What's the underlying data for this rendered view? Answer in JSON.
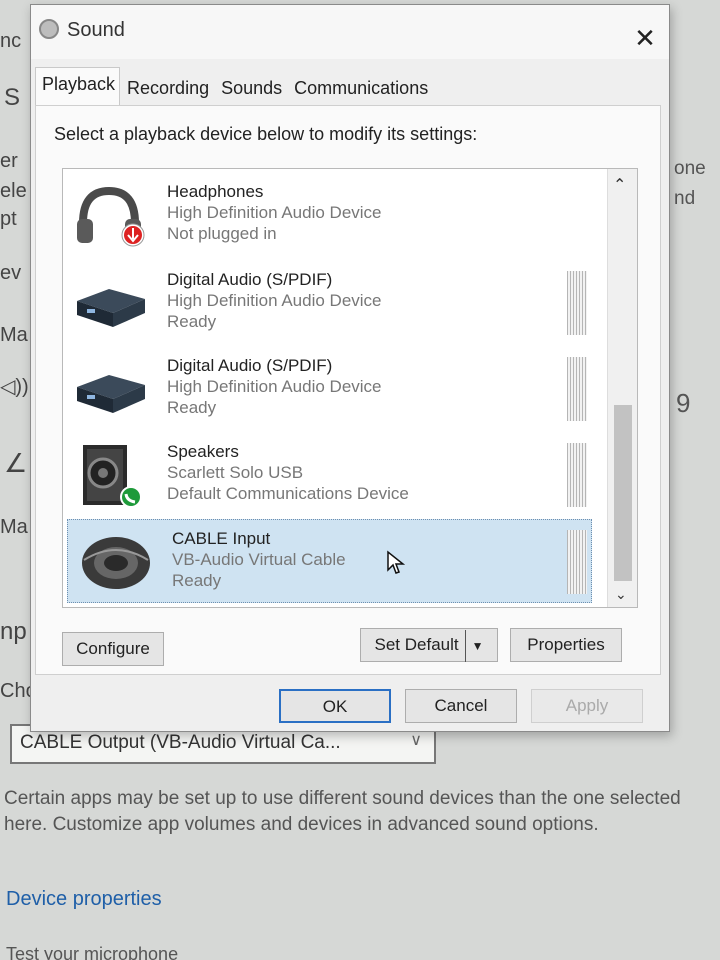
{
  "background": {
    "left_fragments": [
      "nc",
      "S",
      "er",
      "ele",
      "pt",
      "ev",
      "Ma",
      "◁))",
      "∠",
      "Ma",
      "np",
      "Cho"
    ],
    "right_fragments": [
      "one",
      "nd",
      "9"
    ],
    "dropdown": {
      "value": "CABLE Output (VB-Audio Virtual Ca...",
      "icon": "chevron-down-icon"
    },
    "description": "Certain apps may be set up to use different sound devices than the one selected here. Customize app volumes and devices in advanced sound options.",
    "link": "Device properties",
    "cut_text": "Test your microphone"
  },
  "dialog": {
    "title": "Sound",
    "tabs": [
      "Playback",
      "Recording",
      "Sounds",
      "Communications"
    ],
    "active_tab": "Playback",
    "instruction": "Select a playback device below to modify its settings:",
    "devices": [
      {
        "name": "Headphones",
        "line2": "High Definition Audio Device",
        "line3": "Not plugged in",
        "icon": "headphones-icon",
        "badge": "red-down-arrow"
      },
      {
        "name": "Digital Audio (S/PDIF)",
        "line2": "High Definition Audio Device",
        "line3": "Ready",
        "icon": "spdif-box-icon"
      },
      {
        "name": "Digital Audio (S/PDIF)",
        "line2": "High Definition Audio Device",
        "line3": "Ready",
        "icon": "spdif-box-icon"
      },
      {
        "name": "Speakers",
        "line2": "Scarlett Solo USB",
        "line3": "Default Communications Device",
        "icon": "speaker-icon",
        "badge": "green-phone"
      },
      {
        "name": "CABLE Input",
        "line2": "VB-Audio Virtual Cable",
        "line3": "Ready",
        "icon": "cable-icon",
        "selected": true
      }
    ],
    "buttons": {
      "configure": "Configure",
      "set_default": "Set Default",
      "properties": "Properties",
      "ok": "OK",
      "cancel": "Cancel",
      "apply": "Apply"
    },
    "colors": {
      "selection": "#cfe3f2",
      "default_button_border": "#2a6fc4"
    }
  }
}
